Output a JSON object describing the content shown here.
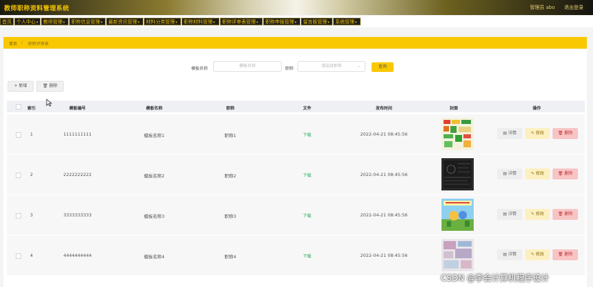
{
  "header": {
    "app_title": "教师职称资料管理系统",
    "admin_label": "管理员 abo",
    "logout_label": "退出登录"
  },
  "nav": {
    "items": [
      {
        "label": "首页",
        "has_menu": false
      },
      {
        "label": "个人中心",
        "has_menu": true
      },
      {
        "label": "教师管理",
        "has_menu": true
      },
      {
        "label": "职称信息管理",
        "has_menu": true
      },
      {
        "label": "最新资讯管理",
        "has_menu": true
      },
      {
        "label": "材料分类管理",
        "has_menu": true
      },
      {
        "label": "职称材料管理",
        "has_menu": true
      },
      {
        "label": "职称评审表管理",
        "has_menu": true
      },
      {
        "label": "职称申报管理",
        "has_menu": true
      },
      {
        "label": "留言板管理",
        "has_menu": true
      },
      {
        "label": "系统管理",
        "has_menu": true
      }
    ]
  },
  "breadcrumb": {
    "home": "首页",
    "separator": "/",
    "current": "职称评审表"
  },
  "search": {
    "name_label": "模板名称",
    "name_placeholder": "模板名称",
    "title_label": "职称",
    "title_placeholder": "请选择职称",
    "search_button": "查询"
  },
  "toolbar": {
    "add_label": "+ 新增",
    "delete_label": "删除"
  },
  "table": {
    "headers": [
      "索引",
      "模板编号",
      "模板名称",
      "职称",
      "文件",
      "发布时间",
      "封面",
      "操作"
    ],
    "rows": [
      {
        "index": "1",
        "code": "1111111111",
        "name": "模板名称1",
        "title": "职称1",
        "file": "下载",
        "time": "2022-04-21 08:45:56"
      },
      {
        "index": "2",
        "code": "2222222222",
        "name": "模板名称2",
        "title": "职称2",
        "file": "下载",
        "time": "2022-04-21 08:45:56"
      },
      {
        "index": "3",
        "code": "3333333333",
        "name": "模板名称3",
        "title": "职称3",
        "file": "下载",
        "time": "2022-04-21 08:45:56"
      },
      {
        "index": "4",
        "code": "4444444444",
        "name": "模板名称4",
        "title": "职称4",
        "file": "下载",
        "time": "2022-04-21 08:45:56"
      }
    ],
    "actions": {
      "detail": "详情",
      "edit": "修改",
      "delete": "删除"
    }
  },
  "watermark": "CSDN @李会计算机程序设计",
  "colors": {
    "accent": "#f9c800",
    "nav_bg": "#1e1e1e",
    "nav_text": "#f0c000",
    "download": "#2aaa5a",
    "delete_bg": "#f8c4c4",
    "edit_bg": "#fdf0c0"
  }
}
